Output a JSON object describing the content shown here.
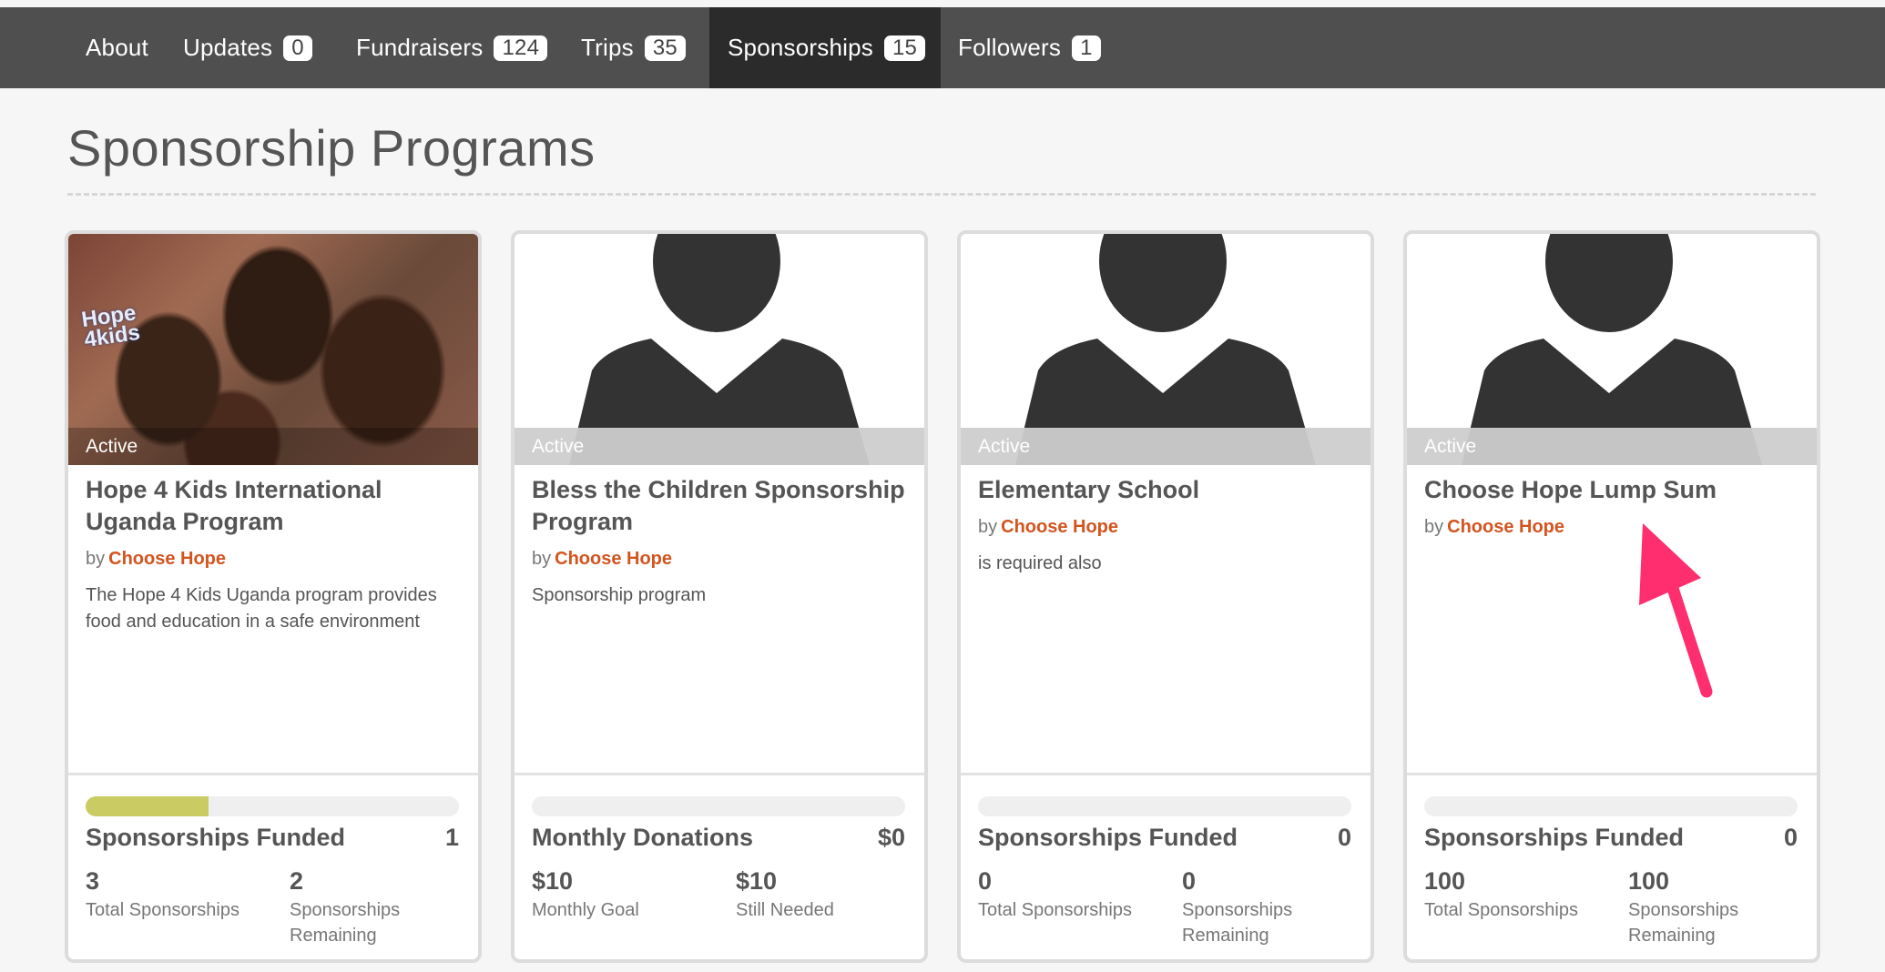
{
  "nav": [
    {
      "label": "About",
      "count": ""
    },
    {
      "label": "Updates",
      "count": "0"
    },
    {
      "label": "Fundraisers",
      "count": "124"
    },
    {
      "label": "Trips",
      "count": "35"
    },
    {
      "label": "Sponsorships",
      "count": "15"
    },
    {
      "label": "Followers",
      "count": "1"
    }
  ],
  "page": {
    "title": "Sponsorship Programs"
  },
  "cards": [
    {
      "status": "Active",
      "title": "Hope 4 Kids International Uganda Program",
      "by": "by",
      "org": "Choose Hope",
      "desc": "The Hope 4 Kids Uganda program provides food and education in a safe environment",
      "photo_logo": "Hope 4 kids",
      "progress_fraction": 0.33,
      "stat_label": "Sponsorships Funded",
      "stat_value": "1",
      "a_value": "3",
      "a_label": "Total Sponsorships",
      "b_value": "2",
      "b_label": "Sponsorships Remaining"
    },
    {
      "status": "Active",
      "title": "Bless the Children Sponsorship Program",
      "by": "by",
      "org": "Choose Hope",
      "desc": "Sponsorship program",
      "progress_fraction": 0,
      "stat_label": "Monthly Donations",
      "stat_value": "$0",
      "a_value": "$10",
      "a_label": "Monthly Goal",
      "b_value": "$10",
      "b_label": "Still Needed"
    },
    {
      "status": "Active",
      "title": "Elementary School",
      "by": "by",
      "org": "Choose Hope",
      "desc": "is required also",
      "progress_fraction": 0,
      "stat_label": "Sponsorships Funded",
      "stat_value": "0",
      "a_value": "0",
      "a_label": "Total Sponsorships",
      "b_value": "0",
      "b_label": "Sponsorships Remaining"
    },
    {
      "status": "Active",
      "title": "Choose Hope Lump Sum",
      "by": "by",
      "org": "Choose Hope",
      "desc": "",
      "progress_fraction": 0,
      "stat_label": "Sponsorships Funded",
      "stat_value": "0",
      "a_value": "100",
      "a_label": "Total Sponsorships",
      "b_value": "100",
      "b_label": "Sponsorships Remaining"
    }
  ],
  "colors": {
    "accent_org": "#d3541f",
    "progress": "#cbcb64",
    "annotation_arrow": "#ff2e6e",
    "nav_bg": "#4f4f50"
  },
  "icons": [
    "person-silhouette-icon",
    "annotation-arrow-icon"
  ]
}
